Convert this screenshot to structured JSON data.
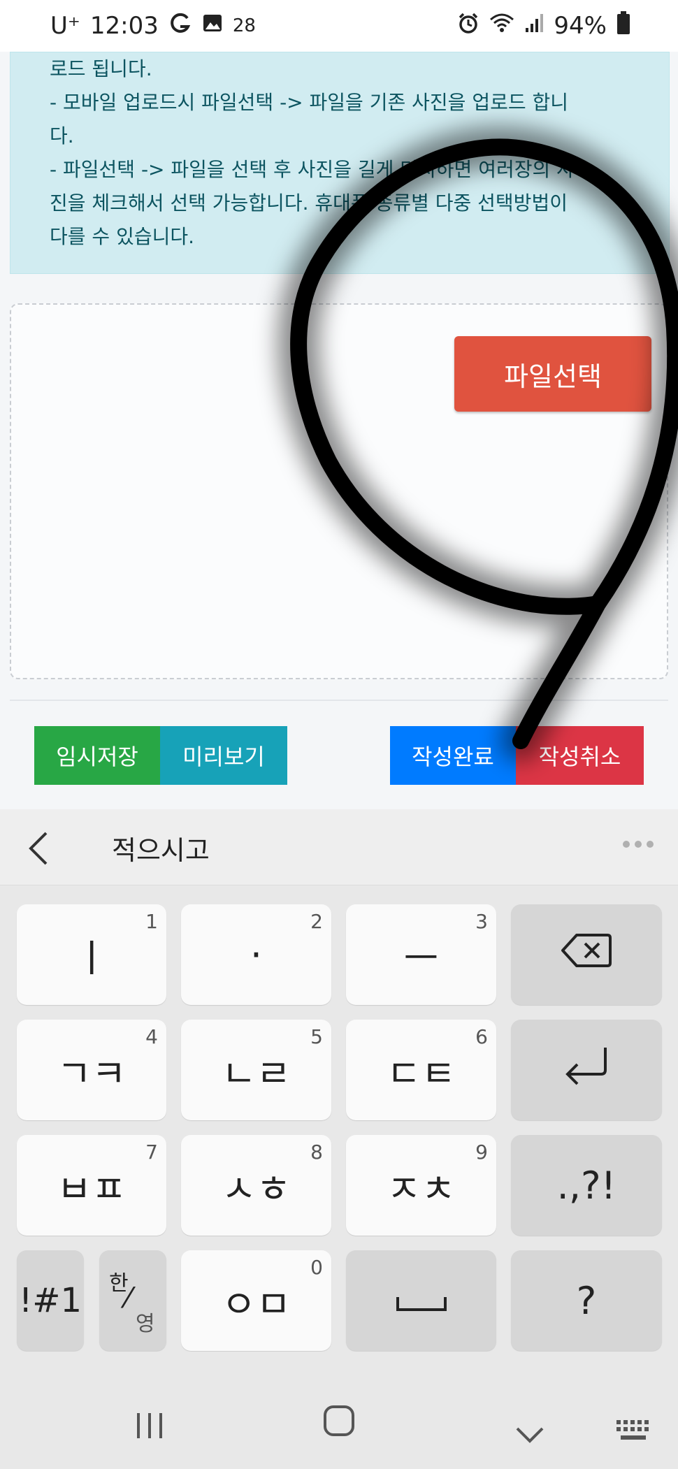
{
  "status_bar": {
    "carrier": "U⁺",
    "time": "12:03",
    "notif_count": "28",
    "battery": "94%"
  },
  "alert": {
    "lines": [
      "로드 됩니다.",
      "- 모바일 업로드시 파일선택 -> 파일을 기존 사진을 업로드 합니",
      "다.",
      "- 파일선택 -> 파일을 선택 후 사진을 길게 터치하면 여러장의 사",
      "진을 체크해서 선택 가능합니다. 휴대폰 종류별 다중 선택방법이",
      "다를 수 있습니다."
    ]
  },
  "upload": {
    "file_select_label": "파일선택"
  },
  "actions": {
    "temp_save": "임시저장",
    "preview": "미리보기",
    "complete": "작성완료",
    "cancel": "작성취소"
  },
  "keyboard": {
    "suggestion": "적으시고",
    "keys": {
      "k1": "ㅣ",
      "k1n": "1",
      "k2": "·",
      "k2n": "2",
      "k3": "ㅡ",
      "k3n": "3",
      "k4": "ㄱㅋ",
      "k4n": "4",
      "k5": "ㄴㄹ",
      "k5n": "5",
      "k6": "ㄷㅌ",
      "k6n": "6",
      "k7": "ㅂㅍ",
      "k7n": "7",
      "k8": "ㅅㅎ",
      "k8n": "8",
      "k9": "ㅈㅊ",
      "k9n": "9",
      "k0": "ㅇㅁ",
      "k0n": "0",
      "punct": ".,?!",
      "sym": "!#1",
      "lang_top": "한",
      "lang_bottom": "영",
      "question": "?"
    }
  }
}
